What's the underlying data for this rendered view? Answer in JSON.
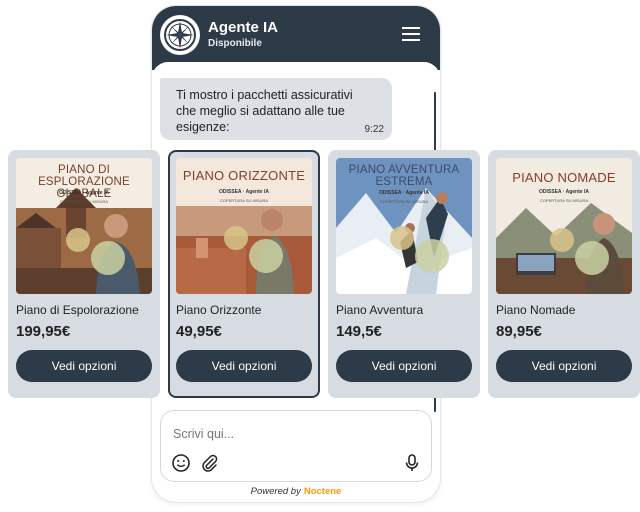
{
  "header": {
    "title": "Agente IA",
    "status": "Disponibile",
    "avatar_icon": "compass-rose-icon",
    "menu_icon": "hamburger-menu-icon"
  },
  "message": {
    "text": "Ti mostro i pacchetti assicurativi che meglio si adattano alle tue esigenze:",
    "time": "9:22"
  },
  "cards": [
    {
      "poster_title": "PIANO DI ESPLORAZIONE GLOBALE",
      "name": "Piano di Espolorazione",
      "price": "199,95€",
      "button": "Vedi opzioni"
    },
    {
      "poster_title": "PIANO ORIZZONTE",
      "name": "Piano Orizzonte",
      "price": "49,95€",
      "button": "Vedi opzioni"
    },
    {
      "poster_title": "PIANO AVVENTURA ESTREMA",
      "name": "Piano Avventura",
      "price": "149,5€",
      "button": "Vedi opzioni"
    },
    {
      "poster_title": "PIANO NOMADE",
      "name": "Piano Nomade",
      "price": "89,95€",
      "button": "Vedi opzioni"
    }
  ],
  "poster_brand": "ODISSEA · Agente IA",
  "poster_tagline": "COPERTURA SU MISURA",
  "input": {
    "placeholder": "Scrivi qui..."
  },
  "icons": {
    "emoji": "smiley-icon",
    "attach": "paperclip-icon",
    "voice": "microphone-icon"
  },
  "footer": {
    "powered": "Powered by",
    "brand": "Noctene"
  },
  "colors": {
    "header": "#2d3a47",
    "card_bg": "#d6dce1",
    "bubble": "#dde1e5",
    "accent": "#f39c12"
  }
}
